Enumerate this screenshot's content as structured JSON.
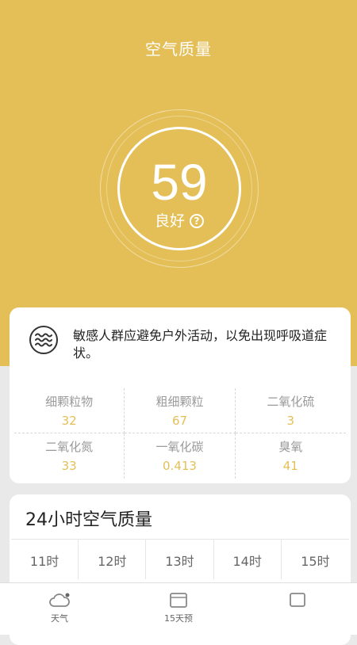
{
  "header": {
    "title": "空气质量"
  },
  "aqi": {
    "value": "59",
    "status": "良好",
    "help_glyph": "?"
  },
  "advice": {
    "text": "敏感人群应避免户外活动，以免出现呼吸道症状。",
    "icon": "waves-icon"
  },
  "pollutants": [
    {
      "name": "细颗粒物",
      "value": "32"
    },
    {
      "name": "粗细颗粒",
      "value": "67"
    },
    {
      "name": "二氧化硫",
      "value": "3"
    },
    {
      "name": "二氧化氮",
      "value": "33"
    },
    {
      "name": "一氧化碳",
      "value": "0.413"
    },
    {
      "name": "臭氧",
      "value": "41"
    }
  ],
  "hourly": {
    "title": "24小时空气质量",
    "hours": [
      "11时",
      "12时",
      "13时",
      "14时",
      "15时"
    ]
  },
  "nav": {
    "items": [
      {
        "label": "天气",
        "icon": "cloud-icon"
      },
      {
        "label": "15天预",
        "icon": "calendar-icon"
      },
      {
        "label": "",
        "icon": "more-icon"
      }
    ]
  },
  "colors": {
    "accent": "#e4bf57",
    "background": "#e9e9e9"
  }
}
